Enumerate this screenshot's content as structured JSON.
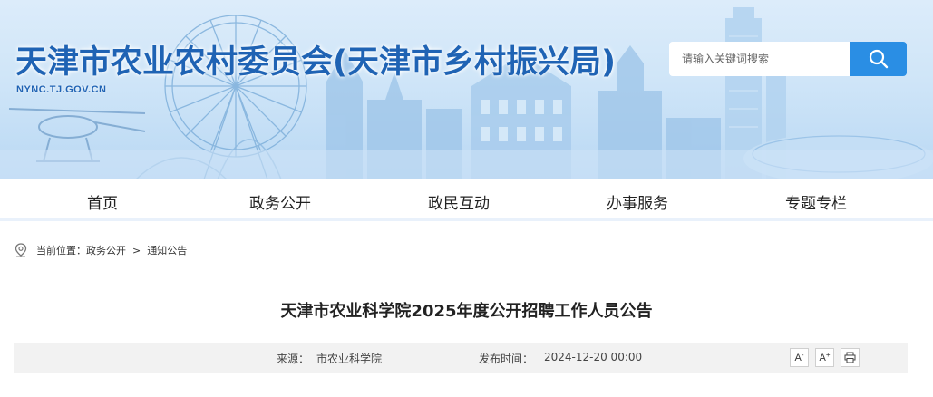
{
  "header": {
    "site_title": "天津市农业农村委员会(天津市乡村振兴局)",
    "site_url": "NYNC.TJ.GOV.CN"
  },
  "search": {
    "placeholder": "请输入关键词搜索",
    "button_icon": "search-icon"
  },
  "nav": {
    "items": [
      {
        "label": "首页"
      },
      {
        "label": "政务公开"
      },
      {
        "label": "政民互动"
      },
      {
        "label": "办事服务"
      },
      {
        "label": "专题专栏"
      }
    ]
  },
  "breadcrumb": {
    "icon": "location-pin-icon",
    "prefix": "当前位置：",
    "items": [
      "政务公开",
      "通知公告"
    ],
    "separator": ">"
  },
  "article": {
    "title": "天津市农业科学院2025年度公开招聘工作人员公告",
    "source_label": "来源：",
    "source_value": "市农业科学院",
    "date_label": "发布时间：",
    "date_value": "2024-12-20 00:00"
  },
  "tools": {
    "font_decrease": "A",
    "font_decrease_sup": "-",
    "font_increase": "A",
    "font_increase_sup": "+",
    "print_icon": "printer-icon"
  },
  "colors": {
    "title_blue": "#1f63b4",
    "search_button": "#2a8ee4",
    "meta_bar": "#f2f2f2"
  }
}
